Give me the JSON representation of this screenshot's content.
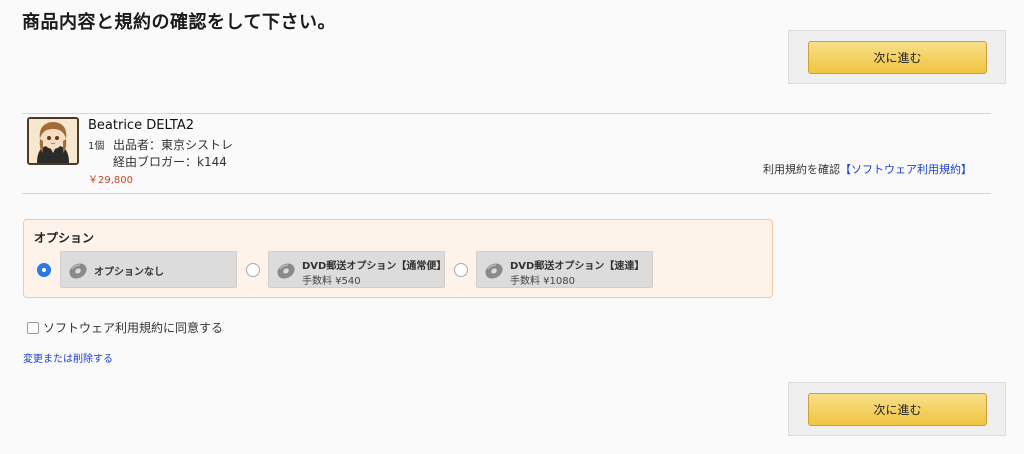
{
  "header": {
    "title": "商品内容と規約の確認をして下さい。"
  },
  "next_button": {
    "label": "次に進む"
  },
  "product": {
    "name": "Beatrice DELTA2",
    "quantity": "1個",
    "seller": "出品者：東京シストレ",
    "blogger": "経由ブロガー：k144",
    "price": "￥29,800"
  },
  "terms": {
    "prefix": "利用規約を確認",
    "link": "【ソフトウェア利用規約】"
  },
  "options": {
    "title": "オプション",
    "items": [
      {
        "label": "オプションなし",
        "fee": "",
        "selected": true
      },
      {
        "label": "DVD郵送オプション【通常便】",
        "fee": "手数料 ¥540",
        "selected": false
      },
      {
        "label": "DVD郵送オプション【速達】",
        "fee": "手数料 ¥1080",
        "selected": false
      }
    ]
  },
  "agreement": {
    "label": "ソフトウェア利用規約に同意する",
    "checked": false
  },
  "change_link": {
    "label": "変更または削除する"
  },
  "colors": {
    "button_yellow": "#efc43f",
    "link_blue": "#1a3fd6",
    "price_red": "#c4492a",
    "option_bg": "#fdf3ea"
  }
}
